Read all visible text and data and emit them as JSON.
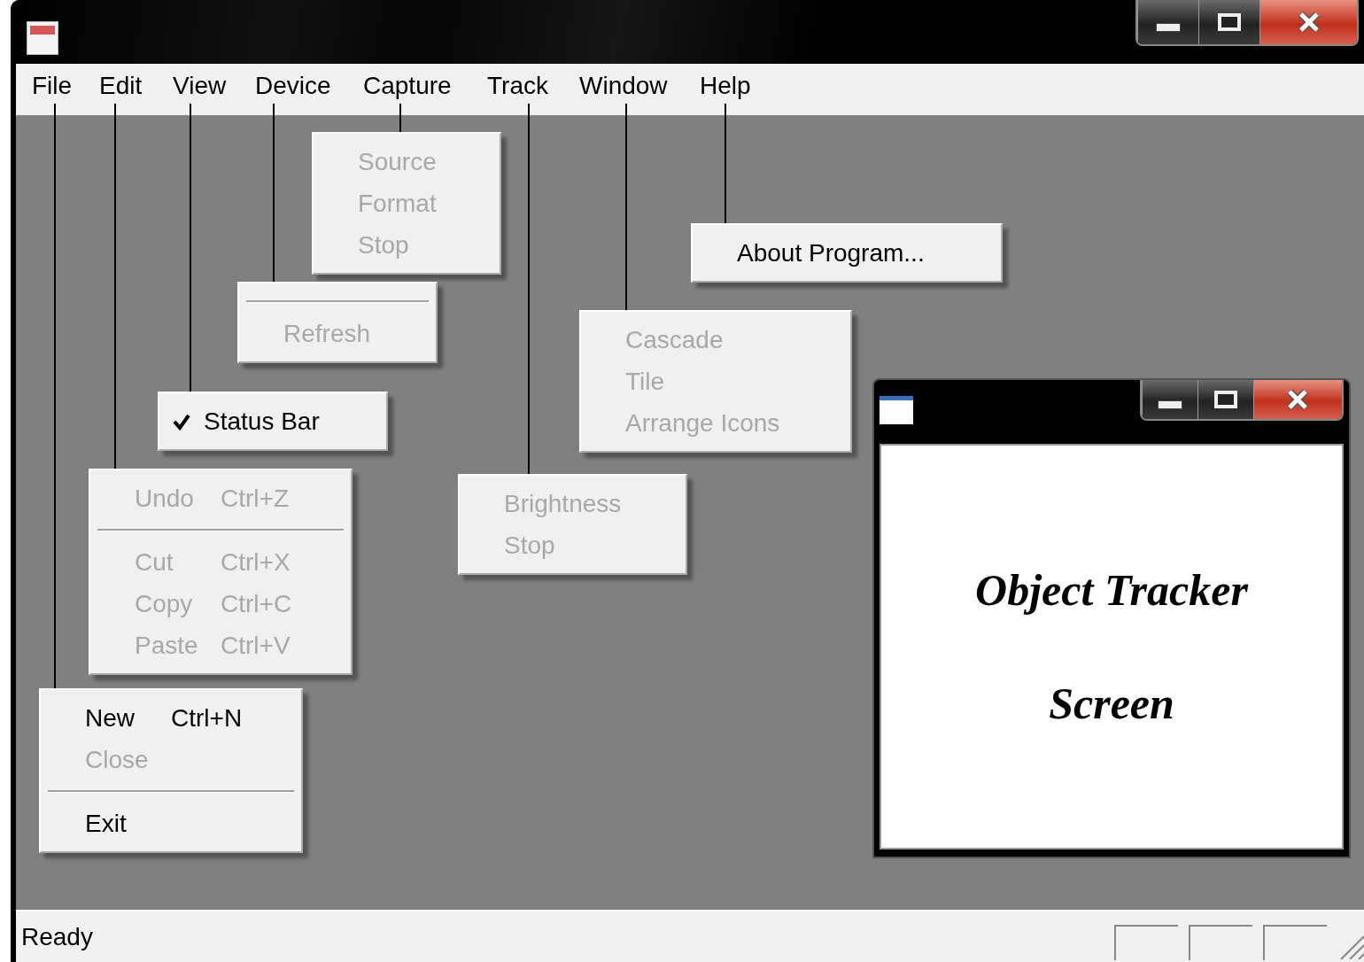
{
  "window": {
    "menu_bar": [
      {
        "label": "File",
        "menu": [
          {
            "kind": "item",
            "label": "New",
            "shortcut": "Ctrl+N",
            "disabled": false
          },
          {
            "kind": "item",
            "label": "Close",
            "disabled": true
          },
          {
            "kind": "separator"
          },
          {
            "kind": "item",
            "label": "Exit",
            "disabled": false
          }
        ]
      },
      {
        "label": "Edit",
        "menu": [
          {
            "kind": "item",
            "label": "Undo",
            "shortcut": "Ctrl+Z",
            "disabled": true
          },
          {
            "kind": "separator"
          },
          {
            "kind": "item",
            "label": "Cut",
            "shortcut": "Ctrl+X",
            "disabled": true
          },
          {
            "kind": "item",
            "label": "Copy",
            "shortcut": "Ctrl+C",
            "disabled": true
          },
          {
            "kind": "item",
            "label": "Paste",
            "shortcut": "Ctrl+V",
            "disabled": true
          }
        ]
      },
      {
        "label": "View",
        "menu": [
          {
            "kind": "item",
            "label": "Status Bar",
            "disabled": false,
            "checked": true
          }
        ]
      },
      {
        "label": "Device",
        "menu": [
          {
            "kind": "separator"
          },
          {
            "kind": "item",
            "label": "Refresh",
            "disabled": true
          }
        ]
      },
      {
        "label": "Capture",
        "menu": [
          {
            "kind": "item",
            "label": "Source",
            "disabled": true
          },
          {
            "kind": "item",
            "label": "Format",
            "disabled": true
          },
          {
            "kind": "item",
            "label": "Stop",
            "disabled": true
          }
        ]
      },
      {
        "label": "Track",
        "menu": [
          {
            "kind": "item",
            "label": "Brightness",
            "disabled": true
          },
          {
            "kind": "item",
            "label": "Stop",
            "disabled": true
          }
        ]
      },
      {
        "label": "Window",
        "menu": [
          {
            "kind": "item",
            "label": "Cascade",
            "disabled": true
          },
          {
            "kind": "item",
            "label": "Tile",
            "disabled": true
          },
          {
            "kind": "item",
            "label": "Arrange Icons",
            "disabled": true
          }
        ]
      },
      {
        "label": "Help",
        "menu": [
          {
            "kind": "item",
            "label": "About Program...",
            "disabled": false
          }
        ]
      }
    ]
  },
  "child_window": {
    "lines": [
      "Object Tracker",
      "Screen"
    ]
  },
  "status_bar": {
    "text": "Ready"
  }
}
